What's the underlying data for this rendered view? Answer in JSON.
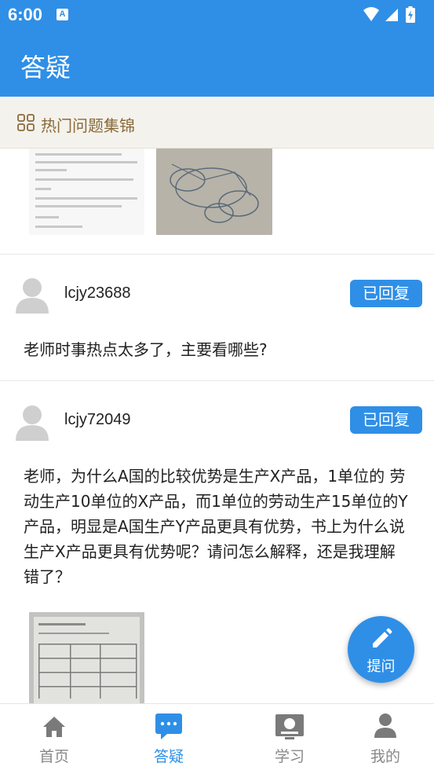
{
  "status_bar": {
    "time": "6:00",
    "notification_icon": "a-square-icon",
    "right_icons": [
      "wifi-icon",
      "signal-icon",
      "battery-charging-icon"
    ]
  },
  "app_bar": {
    "title": "答疑"
  },
  "hot_questions": {
    "icon": "grid-icon",
    "label": "热门问题集锦"
  },
  "posts": [
    {
      "username": "lcjy23688",
      "status": "已回复",
      "question": "老师时事热点太多了，主要看哪些?"
    },
    {
      "username": "lcjy72049",
      "status": "已回复",
      "question": "老师，为什么A国的比较优势是生产X产品，1单位的 劳动生产10单位的X产品，而1单位的劳动生产15单位的Y产品，明显是A国生产Y产品更具有优势，书上为什么说生产X产品更具有优势呢？请问怎么解释，还是我理解错了？"
    }
  ],
  "fab": {
    "icon": "pencil-icon",
    "label": "提问"
  },
  "bottom_nav": [
    {
      "label": "首页",
      "icon": "home-icon",
      "active": false
    },
    {
      "label": "答疑",
      "icon": "chat-bubble-icon",
      "active": true
    },
    {
      "label": "学习",
      "icon": "video-icon",
      "active": false
    },
    {
      "label": "我的",
      "icon": "person-icon",
      "active": false
    }
  ],
  "colors": {
    "primary": "#2f8fe6",
    "hot_bar_bg": "#f4f2ec",
    "hot_bar_text": "#8a6a3a",
    "inactive_nav": "#888888"
  }
}
